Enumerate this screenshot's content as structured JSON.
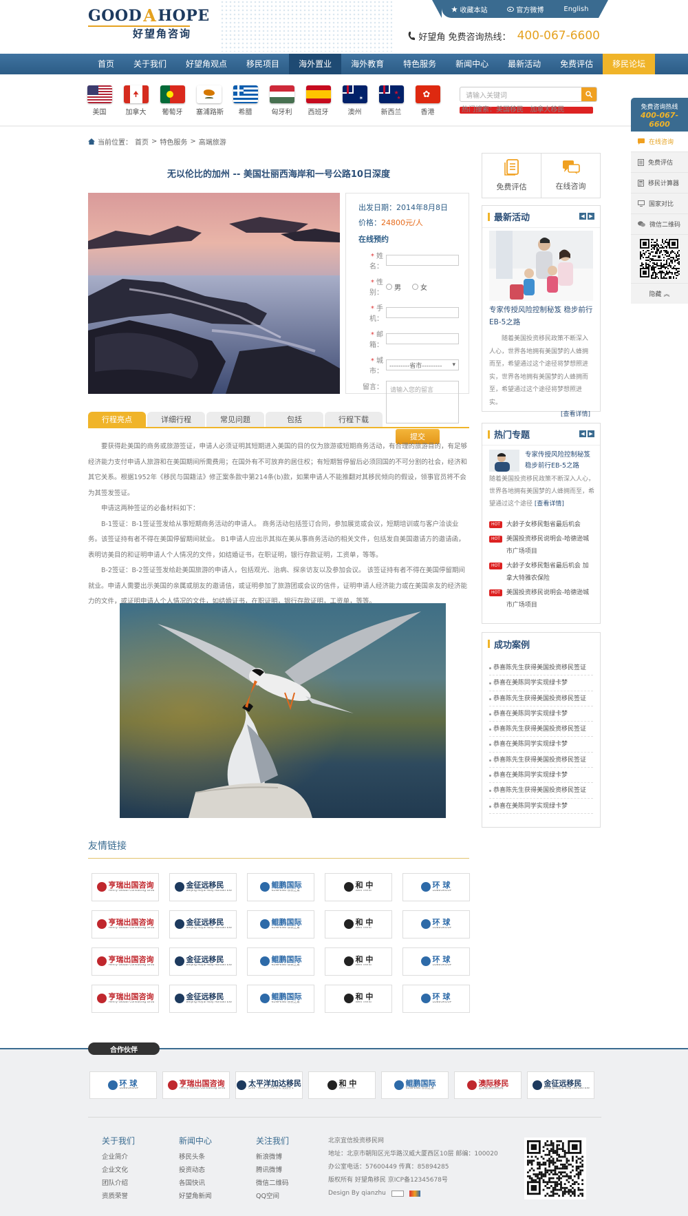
{
  "topbar": {
    "favorite": "收藏本站",
    "weibo": "官方微博",
    "english": "English"
  },
  "logo": {
    "en_left": "GOOD",
    "en_mid": "A",
    "en_right": "HOPE",
    "zh": "好望角咨询"
  },
  "hotline": {
    "label": "好望角 免费咨询热线：",
    "number": "400-067-6600"
  },
  "nav": [
    "首页",
    "关于我们",
    "好望角观点",
    "移民项目",
    "海外置业",
    "海外教育",
    "特色服务",
    "新闻中心",
    "最新活动",
    "免费评估",
    "移民论坛"
  ],
  "flags": [
    "美国",
    "加拿大",
    "葡萄牙",
    "塞浦路斯",
    "希腊",
    "匈牙利",
    "西班牙",
    "澳州",
    "新西兰",
    "香港"
  ],
  "search": {
    "placeholder": "请输入关键词",
    "hot_label": "热门搜索：",
    "hot_1": "美国移民",
    "hot_2": "加拿大移民"
  },
  "breadcrumb": {
    "label": "当前位置：",
    "home": "首页",
    "sep": ">",
    "level1": "特色服务",
    "level2": "高端旅游"
  },
  "page_title": "无以伦比的加州 -- 美国壮丽西海岸和一号公路10日深度",
  "booking": {
    "depart_label": "出发日期：",
    "depart": "2014年8月8日",
    "price_label": "价格：",
    "price": "24800元/人",
    "section": "在线预约",
    "name": "姓名：",
    "gender": "性别：",
    "male": "男",
    "female": "女",
    "phone": "手机：",
    "email": "邮箱：",
    "city": "城市：",
    "city_select": "---------省市---------",
    "message": "留言：",
    "message_placeholder": "请输入您的留言",
    "submit": "提交"
  },
  "tabs": [
    "行程亮点",
    "详细行程",
    "常见问题",
    "包括",
    "行程下载"
  ],
  "article": [
    "要获得赴美国的商务或旅游签证，申请人必须证明其短期进入美国的目的仅为旅游或短期商务活动，有合理的旅游目的，有足够经济能力支付申请人旅游和在美国期间所需费用；在国外有不可放弃的居住权；有短期暂停留后必须回国的不可分割的社会，经济和其它关系。根据1952年《移民与国籍法》修正案条款中第214条(b)款，如果申请人不能推翻对其移民倾向的假设，领事官员将不会为其签发签证。",
    "申请这两种签证的必备材料如下：",
    "B-1签证：B-1签证签发给从事短期商务活动的申请人。 商务活动包括签订合同，参加展览或会议，短期培训或与客户洽谈业务。该签证持有者不得在美国停留期间就业。 B1申请人应出示其拟在美从事商务活动的相关文件，包括发自美国邀请方的邀请函，表明访美目的和证明申请人个人情况的文件，如结婚证书，在职证明，银行存款证明，工资单，等等。",
    "B-2签证：B-2签证签发给赴美国旅游的申请人，包括观光、治病、探亲访友以及参加会议。 该签证持有者不得在美国停留期间就业。申请人需要出示美国的亲属或朋友的邀请信，或证明参加了旅游团或会议的信件，证明申请人经济能力或在美国亲友的经济能力的文件，或证明申请人个人情况的文件，如结婚证书，在职证明，银行存款证明，工资单，等等。"
  ],
  "friend_links_title": "友情链接",
  "link_logos": [
    {
      "main": "亨瑞出国咨询",
      "sub": "Henry Global Consulting Group",
      "color": "#c0272d"
    },
    {
      "main": "金征远移民",
      "sub": "Beijing Royal Way Abroad Exit & Entry Service Co.,Ltd",
      "color": "#1d3a5e"
    },
    {
      "main": "鲲鹏国际",
      "sub": "KUNPENG 移民之家",
      "color": "#2d6aa8"
    },
    {
      "main": "和 中",
      "sub": "Well Trend",
      "color": "#222"
    },
    {
      "main": "环 球",
      "sub": "LOBEGROUP",
      "color": "#2d6aa8"
    }
  ],
  "quick": {
    "assess": "免费评估",
    "consult": "在线咨询"
  },
  "activity": {
    "title": "最新活动",
    "headline": "专家传授风险控制秘笈 稳步前行EB-5之路",
    "text": "随着美国投资移民政策不断深入人心，世界各地拥有美国梦的人蜂拥而至，希望通过这个途径将梦想照进实，世界各地拥有美国梦的人蜂拥而至，希望通过这个途径将梦想照进实。",
    "more": "[查看详情]"
  },
  "topics": {
    "title": "热门专题",
    "headline": "专家传授风险控制秘笈稳步前行EB-5之路",
    "text": "随着美国投资移民政策不断深入人心，世界各地拥有美国梦的人蜂拥而至，希望通过这个途径",
    "more": "[查看详情]",
    "hot_label": "HOT",
    "items": [
      "大龄子女移民魁省最后机会",
      "美国投资移民说明会-哈德逊城市广场项目",
      "大龄子女移民魁省最后机会 加拿大特雅农保险",
      "美国投资移民说明会-哈德逊城市广场项目"
    ]
  },
  "cases": {
    "title": "成功案例",
    "items": [
      "恭喜陈先生获得美国投资移民签证",
      "恭喜在美陈同学实现绿卡梦",
      "恭喜陈先生获得美国投资移民签证",
      "恭喜在美陈同学实现绿卡梦",
      "恭喜陈先生获得美国投资移民签证",
      "恭喜在美陈同学实现绿卡梦",
      "恭喜陈先生获得美国投资移民签证",
      "恭喜在美陈同学实现绿卡梦",
      "恭喜陈先生获得美国投资移民签证",
      "恭喜在美陈同学实现绿卡梦"
    ]
  },
  "float": {
    "hotline_label": "免费咨询热线",
    "hotline": "400-067-6600",
    "items": [
      "在线咨询",
      "免费评估",
      "移民计算器",
      "国家对比",
      "微信二维码"
    ],
    "hide": "隐藏"
  },
  "partner": {
    "title": "合作伙伴",
    "logos": [
      {
        "main": "环 球",
        "sub": "LOBEGROUP",
        "color": "#2d6aa8"
      },
      {
        "main": "亨瑞出国咨询",
        "sub": "Henry Global Consulting Group",
        "color": "#c0272d"
      },
      {
        "main": "太平洋加达移民",
        "sub": "CAN - REACH PACIFIC 始创于1995年",
        "color": "#1d3a5e"
      },
      {
        "main": "和 中",
        "sub": "Well Trend",
        "color": "#222"
      },
      {
        "main": "鲲鹏国际",
        "sub": "KUNPENG 移民之家",
        "color": "#2d6aa8"
      },
      {
        "main": "澳际移民",
        "sub": "全球投资移民机构",
        "color": "#c0272d"
      },
      {
        "main": "金征远移民",
        "sub": "Beijing Royal Way Abroad Exit & Entry Service Co.,Ltd",
        "color": "#1d3a5e"
      }
    ]
  },
  "footer": {
    "about": {
      "title": "关于我们",
      "items": [
        "企业简介",
        "企业文化",
        "团队介绍",
        "资质荣誉"
      ]
    },
    "news": {
      "title": "新闻中心",
      "items": [
        "移民头条",
        "投资动态",
        "各国快讯",
        "好望角新闻"
      ]
    },
    "follow": {
      "title": "关注我们",
      "items": [
        "新浪微博",
        "腾讯微博",
        "微信二维码",
        "QQ空间"
      ]
    },
    "info": [
      "北京宜信投资移民网",
      "地址：北京市朝阳区光华路汉威大厦西区10层 邮编：100020",
      "办公室电话：57600449 传真：85894285",
      "版权所有 好望角移民 京ICP备12345678号",
      "Design By qianzhu"
    ]
  }
}
